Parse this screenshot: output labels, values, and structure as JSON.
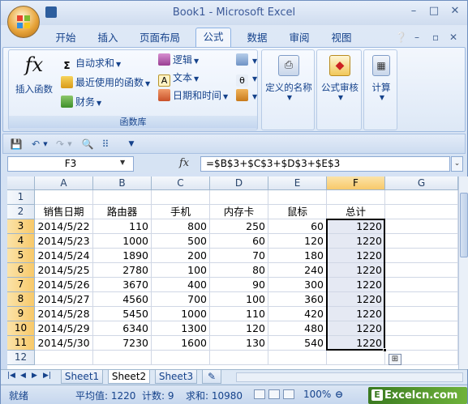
{
  "window": {
    "title": "Book1 - Microsoft Excel",
    "minimize": "–",
    "maximize": "□",
    "close": "✕"
  },
  "tabs": [
    "开始",
    "插入",
    "页面布局",
    "公式",
    "数据",
    "审阅",
    "视图"
  ],
  "active_tab": "公式",
  "ribbon": {
    "insert_function": "插入函数",
    "autosum": "自动求和",
    "recent": "最近使用的函数",
    "financial": "财务",
    "logical": "逻辑",
    "text": "文本",
    "datetime": "日期和时间",
    "group_label": "函数库",
    "defined_names": "定义的名称",
    "formula_auditing": "公式审核",
    "calculation": "计算"
  },
  "formula_bar": {
    "name_box": "F3",
    "fx": "fx",
    "formula": "=$B$3+$C$3+$D$3+$E$3"
  },
  "columns": [
    "A",
    "B",
    "C",
    "D",
    "E",
    "F",
    "G"
  ],
  "selected_column": "F",
  "rows": [
    "1",
    "2",
    "3",
    "4",
    "5",
    "6",
    "7",
    "8",
    "9",
    "10",
    "11",
    "12"
  ],
  "selected_rows": [
    "3",
    "4",
    "5",
    "6",
    "7",
    "8",
    "9",
    "10",
    "11"
  ],
  "headers": [
    "销售日期",
    "路由器",
    "手机",
    "内存卡",
    "鼠标",
    "总计"
  ],
  "data": [
    [
      "2014/5/22",
      "110",
      "800",
      "250",
      "60",
      "1220"
    ],
    [
      "2014/5/23",
      "1000",
      "500",
      "60",
      "120",
      "1220"
    ],
    [
      "2014/5/24",
      "1890",
      "200",
      "70",
      "180",
      "1220"
    ],
    [
      "2014/5/25",
      "2780",
      "100",
      "80",
      "240",
      "1220"
    ],
    [
      "2014/5/26",
      "3670",
      "400",
      "90",
      "300",
      "1220"
    ],
    [
      "2014/5/27",
      "4560",
      "700",
      "100",
      "360",
      "1220"
    ],
    [
      "2014/5/28",
      "5450",
      "1000",
      "110",
      "420",
      "1220"
    ],
    [
      "2014/5/29",
      "6340",
      "1300",
      "120",
      "480",
      "1220"
    ],
    [
      "2014/5/30",
      "7230",
      "1600",
      "130",
      "540",
      "1220"
    ]
  ],
  "sheets": [
    "Sheet1",
    "Sheet2",
    "Sheet3"
  ],
  "active_sheet": "Sheet2",
  "status": {
    "ready": "就绪",
    "average": "平均值: 1220",
    "count": "计数: 9",
    "sum": "求和: 10980",
    "zoom": "100%"
  },
  "brand": "Excelcn.com",
  "colors": {
    "accent": "#15428b",
    "selection": "#f8c96a",
    "grid": "#d0d7e5"
  }
}
